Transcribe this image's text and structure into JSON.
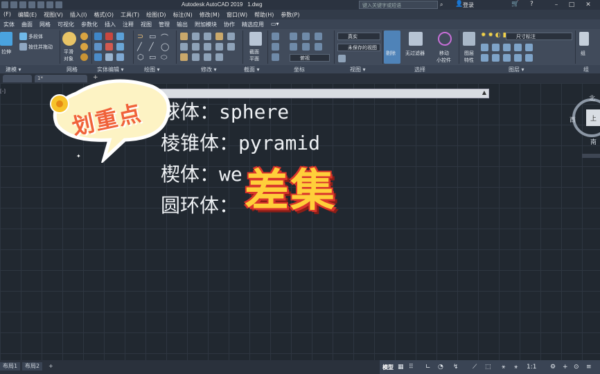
{
  "titlebar": {
    "app_title": "Autodesk AutoCAD 2019",
    "file_name": "1.dwg",
    "search_placeholder": "键入关键字或短语",
    "login_label": "登录"
  },
  "menubar": [
    "(F)",
    "编辑(E)",
    "视图(V)",
    "插入(I)",
    "格式(O)",
    "工具(T)",
    "绘图(D)",
    "标注(N)",
    "修改(M)",
    "窗口(W)",
    "帮助(H)",
    "参数(P)"
  ],
  "ribbon_tabs": [
    "实体",
    "曲面",
    "网格",
    "可视化",
    "参数化",
    "插入",
    "注释",
    "视图",
    "管理",
    "输出",
    "附加模块",
    "协作",
    "精选应用"
  ],
  "ribbon": {
    "labels": {
      "extrude": "拉伸",
      "polysolid": "多段体",
      "presspull": "按住并拖动",
      "smooth_1": "平滑",
      "smooth_2": "对象",
      "section_1": "截面",
      "section_2": "平面",
      "culling": "剔除",
      "nofilter": "无过滤器",
      "move_gizmo_1": "移动",
      "move_gizmo_2": "小控件",
      "layer_props_1": "图层",
      "layer_props_2": "特性",
      "group": "组"
    },
    "selects": {
      "visual_style": "真实",
      "view_saved": "未保存的视图",
      "coords": "俯视",
      "layer_name": "尺寸标注"
    },
    "panels": [
      "建模 ▾",
      "网格",
      "实体编辑 ▾",
      "绘图 ▾",
      "修改 ▾",
      "截面 ▾",
      "坐标",
      "视图 ▾",
      "选择",
      "图层 ▾",
      "组"
    ]
  },
  "doc_tabs": [
    "1*"
  ],
  "drawing": {
    "lines": [
      {
        "cn": "球体：",
        "en": "sphere"
      },
      {
        "cn": "棱锥体：",
        "en": "pyramid"
      },
      {
        "cn": "楔体：",
        "en": "we"
      },
      {
        "cn": "圆环体：",
        "en": ""
      }
    ]
  },
  "sticker_text": "划重点",
  "overlay_text": "差集",
  "viewcube": {
    "north": "北",
    "west": "西",
    "top": "上",
    "south": "南"
  },
  "layout_tabs": [
    "布局1",
    "布局2",
    "+"
  ],
  "status": {
    "model": "模型",
    "scale": "1:1"
  },
  "colors": {
    "canvas_bg": "#212830",
    "overlay_fill": "#ffcf3a",
    "overlay_outline": "#d9342b",
    "sticker_text": "#f0623a"
  }
}
